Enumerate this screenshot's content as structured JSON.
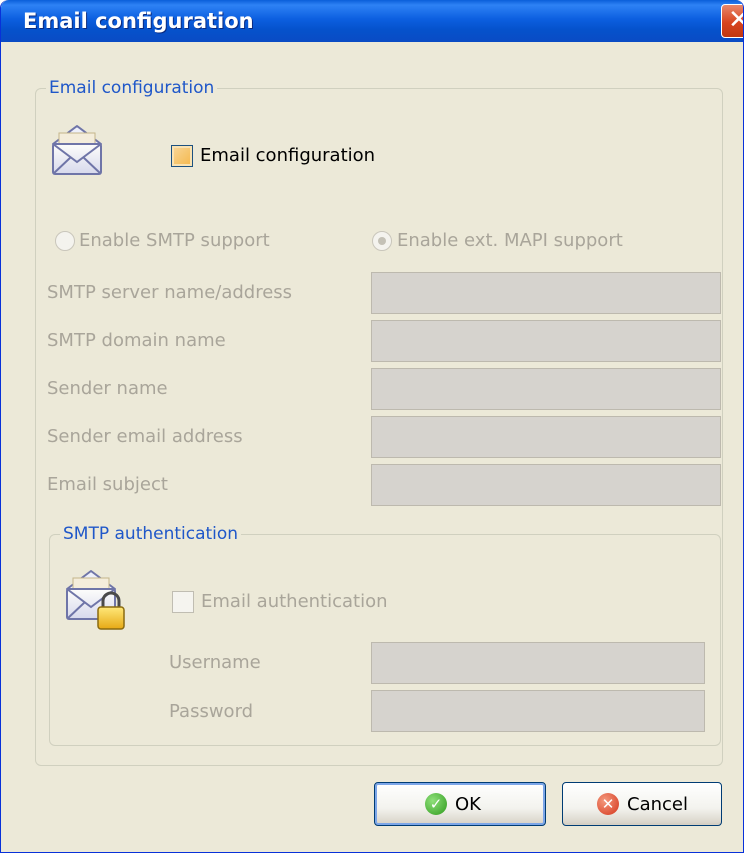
{
  "window": {
    "title": "Email configuration",
    "close_symbol": "✕"
  },
  "email_group": {
    "title": "Email configuration",
    "icon": "envelope-icon",
    "enable_checkbox_label": "Email configuration",
    "enable_checked": false,
    "radio_smtp_label": "Enable SMTP support",
    "radio_smtp_selected": false,
    "radio_mapi_label": "Enable ext. MAPI support",
    "radio_mapi_selected": true,
    "fields": [
      {
        "label": "SMTP server name/address",
        "value": ""
      },
      {
        "label": "SMTP domain name",
        "value": ""
      },
      {
        "label": "Sender name",
        "value": ""
      },
      {
        "label": "Sender email address",
        "value": ""
      },
      {
        "label": "Email subject",
        "value": ""
      }
    ]
  },
  "auth_group": {
    "title": "SMTP authentication",
    "icon": "locked-envelope-icon",
    "checkbox_label": "Email authentication",
    "checked": false,
    "username_label": "Username",
    "username_value": "",
    "password_label": "Password",
    "password_value": ""
  },
  "buttons": {
    "ok_label": "OK",
    "ok_icon": "check-icon",
    "cancel_label": "Cancel",
    "cancel_icon": "cancel-icon"
  },
  "colors": {
    "titlebar": "#0552cc",
    "dialog_bg": "#ece9d8",
    "group_title": "#1f57c9",
    "disabled_text": "#a9a59a"
  }
}
